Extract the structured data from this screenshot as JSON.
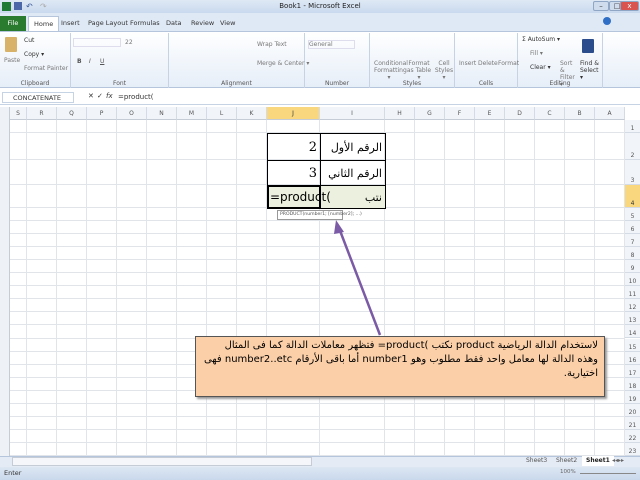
{
  "window": {
    "title": "Book1 - Microsoft Excel"
  },
  "tabs": [
    "File",
    "Home",
    "Insert",
    "Page Layout",
    "Formulas",
    "Data",
    "Review",
    "View"
  ],
  "ribbon": {
    "clipboard": {
      "label": "Clipboard",
      "paste": "Paste",
      "cut": "Cut",
      "copy": "Copy ▾",
      "format_painter": "Format Painter"
    },
    "font": {
      "label": "Font",
      "size": "22"
    },
    "alignment": {
      "label": "Alignment",
      "wrap": "Wrap Text",
      "merge": "Merge & Center ▾"
    },
    "number": {
      "label": "Number",
      "format": "General"
    },
    "styles": {
      "label": "Styles",
      "cond": "Conditional Formatting ▾",
      "table": "Format as Table ▾",
      "cell": "Cell Styles ▾"
    },
    "cells": {
      "label": "Cells",
      "insert": "Insert",
      "delete": "Delete",
      "format": "Format"
    },
    "editing": {
      "label": "Editing",
      "autosum": "Σ AutoSum ▾",
      "fill": "Fill ▾",
      "clear": "Clear ▾",
      "sort": "Sort & Filter ▾",
      "find": "Find & Select ▾"
    }
  },
  "formula_bar": {
    "name_box": "CONCATENATE",
    "formula": "=product(",
    "fx": "fx"
  },
  "columns": [
    "S",
    "R",
    "Q",
    "P",
    "O",
    "N",
    "M",
    "L",
    "K",
    "J",
    "I",
    "H",
    "G",
    "F",
    "E",
    "D",
    "C",
    "B",
    "A"
  ],
  "active_column": "J",
  "rows": [
    "1",
    "2",
    "3",
    "4",
    "5",
    "6",
    "7",
    "8",
    "9",
    "10",
    "11",
    "12",
    "13",
    "14",
    "15",
    "16",
    "17",
    "18",
    "19",
    "20",
    "21",
    "22",
    "23"
  ],
  "active_row": "4",
  "cells": {
    "I2": "الرقم الأول",
    "J2": "2",
    "I3": "الرقم الثاني",
    "J3": "3",
    "I4": "نتب",
    "J4": "=product("
  },
  "tooltip": "PRODUCT(number1; [number2]; ...)",
  "callout": {
    "text": "لاستخدام الدالة الرياضية product نكتب )product= فتظهر معاملات الدالة كما فى المثال وهذه الدالة لها معامل واحد فقط مطلوب وهو number1 أما باقى الأرقام number2..etc فهى اختيارية.",
    "fill": "#fbcfa8"
  },
  "arrow_color": "#7b5aa6",
  "sheets": [
    "Sheet3",
    "Sheet2",
    "Sheet1"
  ],
  "active_sheet": "Sheet1",
  "status": {
    "mode": "Enter",
    "zoom": "100%"
  }
}
